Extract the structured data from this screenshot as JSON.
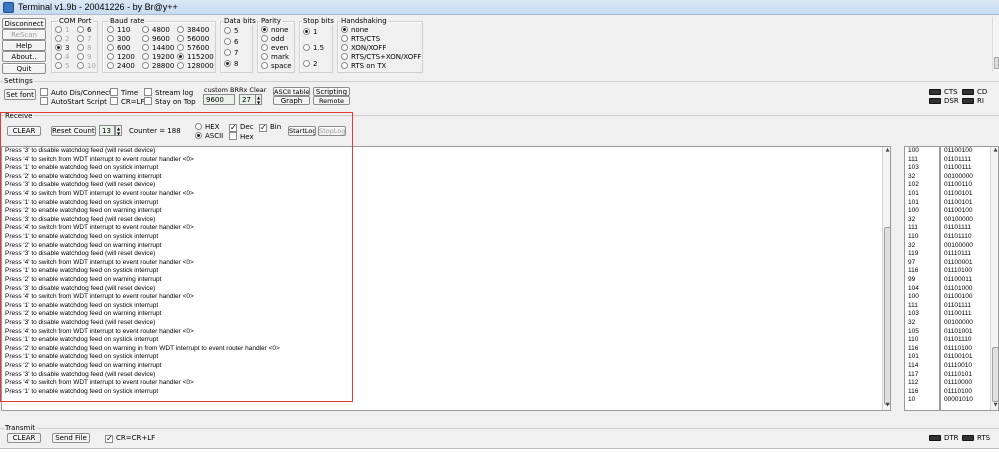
{
  "window": {
    "title": "Terminal v1.9b - 20041226 - by Br@y++"
  },
  "left_buttons": [
    "Disconnect",
    "ReScan",
    "Help",
    "About..",
    "Quit"
  ],
  "com_port": {
    "title": "COM Port",
    "options": [
      "1",
      "2",
      "3",
      "4",
      "5",
      "6",
      "7",
      "8",
      "9",
      "10"
    ],
    "selected": "3"
  },
  "baud_rate": {
    "title": "Baud rate",
    "options": [
      "110",
      "300",
      "600",
      "1200",
      "2400",
      "4800",
      "9600",
      "14400",
      "19200",
      "28800",
      "38400",
      "56000",
      "57600",
      "115200",
      "128000",
      "256000",
      "custom"
    ],
    "selected": "115200"
  },
  "data_bits": {
    "title": "Data bits",
    "options": [
      "5",
      "6",
      "7",
      "8"
    ],
    "selected": "8"
  },
  "parity": {
    "title": "Parity",
    "options": [
      "none",
      "odd",
      "even",
      "mark",
      "space"
    ],
    "selected": "none"
  },
  "stop_bits": {
    "title": "Stop bits",
    "options": [
      "1",
      "1.5",
      "2"
    ],
    "selected": "1"
  },
  "handshaking": {
    "title": "Handshaking",
    "options": [
      "none",
      "RTS/CTS",
      "XON/XOFF",
      "RTS/CTS+XON/XOFF",
      "RTS on TX"
    ],
    "selected": "none"
  },
  "settings": {
    "title": "Settings",
    "set_font": "Set font",
    "checks": [
      "Auto Dis/Connect",
      "AutoStart Script",
      "Time",
      "CR=LF",
      "Stream log",
      "Stay on Top"
    ],
    "custom_br_label": "custom BR",
    "custom_br_value": "9600",
    "rx_clear_label": "Rx Clear",
    "rx_clear_value": "27",
    "ascii_table": "ASCII table",
    "graph": "Graph",
    "scripting": "Scripting",
    "remote": "Remote"
  },
  "status_leds": {
    "cts": "CTS",
    "cd": "CD",
    "dsr": "DSR",
    "ri": "RI",
    "dtr": "DTR",
    "rts": "RTS"
  },
  "receive": {
    "title": "Receive",
    "clear": "CLEAR",
    "reset_counter": "Reset Counter",
    "counter_spin": "13",
    "counter_text": "Counter = 188",
    "hex": "HEX",
    "ascii": "ASCII",
    "dec": "Dec",
    "hex_chk": "Hex",
    "bin": "Bin",
    "start_log": "StartLog",
    "stop_log": "StopLog"
  },
  "console_lines": [
    "Press '3' to disable watchdog feed (will reset device)",
    "Press '4' to switch from WDT interrupt to event router handler <0>",
    "Press '1' to enable watchdog feed on systick interrupt",
    "Press '2' to enable watchdog feed on warning interrupt",
    "Press '3' to disable watchdog feed (will reset device)",
    "Press '4' to switch from WDT interrupt to event router handler <0>",
    "Press '1' to enable watchdog feed on systick interrupt",
    "Press '2' to enable watchdog feed on warning interrupt",
    "Press '3' to disable watchdog feed (will reset device)",
    "Press '4' to switch from WDT interrupt to event router handler <0>",
    "Press '1' to enable watchdog feed on systick interrupt",
    "Press '2' to enable watchdog feed on warning interrupt",
    "Press '3' to disable watchdog feed (will reset device)",
    "Press '4' to switch from WDT interrupt to event router handler <0>",
    "Press '1' to enable watchdog feed on systick interrupt",
    "Press '2' to enable watchdog feed on warning interrupt",
    "Press '3' to disable watchdog feed (will reset device)",
    "Press '4' to switch from WDT interrupt to event router handler <0>",
    "Press '1' to enable watchdog feed on systick interrupt",
    "Press '2' to enable watchdog feed on warning interrupt",
    "Press '3' to disable watchdog feed (will reset device)",
    "Press '4' to switch from WDT interrupt to event router handler <0>",
    "Press '1' to enable watchdog feed on systick interrupt",
    "Press '2' to enable watchdog feed on warning in from WDT interrupt to event router handler <0>",
    "Press '1' to enable watchdog feed on systick interrupt",
    "Press '2' to enable watchdog feed on warning interrupt",
    "Press '3' to disable watchdog feed (will reset device)",
    "Press '4' to switch from WDT interrupt to event router handler <0>",
    "Press '1' to enable watchdog feed on systick interrupt"
  ],
  "dec_values": [
    "100",
    "111",
    "103",
    "32",
    "102",
    "101",
    "101",
    "100",
    "32",
    "111",
    "110",
    "32",
    "119",
    "97",
    "116",
    "99",
    "104",
    "100",
    "111",
    "103",
    "32",
    "105",
    "110",
    "116",
    "101",
    "114",
    "117",
    "112",
    "116",
    "10"
  ],
  "bin_values": [
    "01100100",
    "01101111",
    "01100111",
    "00100000",
    "01100110",
    "01100101",
    "01100101",
    "01100100",
    "00100000",
    "01101111",
    "01101110",
    "00100000",
    "01110111",
    "01100001",
    "01110100",
    "01100011",
    "01101000",
    "01100100",
    "01101111",
    "01100111",
    "00100000",
    "01101001",
    "01101110",
    "01110100",
    "01100101",
    "01110010",
    "01110101",
    "01110000",
    "01110100",
    "00001010"
  ],
  "transmit": {
    "title": "Transmit",
    "clear": "CLEAR",
    "send_file": "Send File",
    "crlf": "CR=CR+LF"
  },
  "colors": {
    "highlight_box": "#e23b3b",
    "led": "#333333"
  }
}
